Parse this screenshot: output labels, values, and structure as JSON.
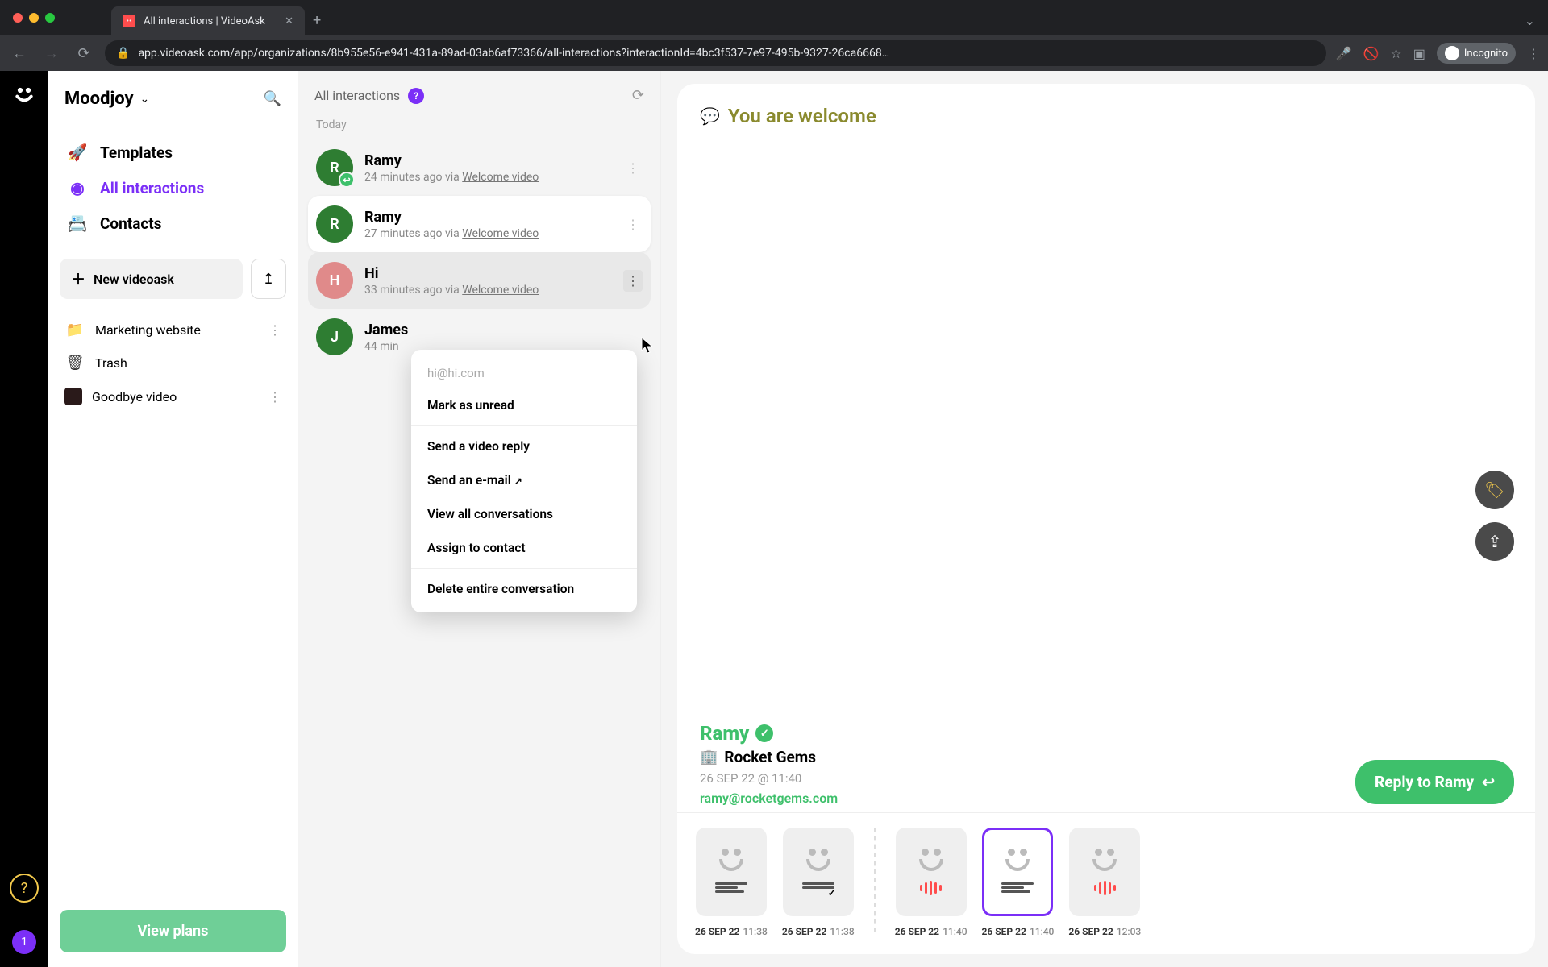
{
  "browser": {
    "tab_title": "All interactions | VideoAsk",
    "url": "app.videoask.com/app/organizations/8b955e56-e941-431a-89ad-03ab6af73366/all-interactions?interactionId=4bc3f537-7e97-495b-9327-26ca6668…",
    "incognito_label": "Incognito"
  },
  "org": {
    "name": "Moodjoy"
  },
  "nav": {
    "templates": "Templates",
    "all_interactions": "All interactions",
    "contacts": "Contacts"
  },
  "actions": {
    "new_videoask": "New videoask",
    "view_plans": "View plans"
  },
  "folders": {
    "marketing": "Marketing website",
    "trash": "Trash",
    "goodbye": "Goodbye video"
  },
  "rail": {
    "count": "1"
  },
  "interactions": {
    "header": "All interactions",
    "day": "Today",
    "items": [
      {
        "name": "Ramy",
        "initial": "R",
        "meta_pre": "24 minutes ago via ",
        "meta_via": "Welcome video",
        "color": "#2e7d32",
        "replied": true
      },
      {
        "name": "Ramy",
        "initial": "R",
        "meta_pre": "27 minutes ago via ",
        "meta_via": "Welcome video",
        "color": "#2e7d32",
        "replied": false
      },
      {
        "name": "Hi",
        "initial": "H",
        "meta_pre": "33 minutes ago via ",
        "meta_via": "Welcome video",
        "color": "#e08a8a",
        "replied": false
      },
      {
        "name": "James",
        "initial": "J",
        "meta_pre": "44 min",
        "meta_via": "",
        "color": "#2e7d32",
        "replied": false
      }
    ]
  },
  "dropdown": {
    "email": "hi@hi.com",
    "mark_unread": "Mark as unread",
    "video_reply": "Send a video reply",
    "send_email": "Send an e-mail",
    "view_all": "View all conversations",
    "assign": "Assign to contact",
    "delete": "Delete entire conversation"
  },
  "detail": {
    "message": "You are welcome",
    "contact_name": "Ramy",
    "company": "Rocket Gems",
    "date": "26 SEP 22 @ 11:40",
    "email": "ramy@rocketgems.com",
    "reply_label": "Reply to Ramy"
  },
  "thumbs": [
    {
      "date": "26 SEP 22",
      "time": "11:38",
      "type": "lines",
      "group": 0
    },
    {
      "date": "26 SEP 22",
      "time": "11:38",
      "type": "check",
      "group": 0
    },
    {
      "date": "26 SEP 22",
      "time": "11:40",
      "type": "audio",
      "group": 1
    },
    {
      "date": "26 SEP 22",
      "time": "11:40",
      "type": "lines",
      "group": 1,
      "active": true
    },
    {
      "date": "26 SEP 22",
      "time": "12:03",
      "type": "audio",
      "group": 1
    }
  ]
}
